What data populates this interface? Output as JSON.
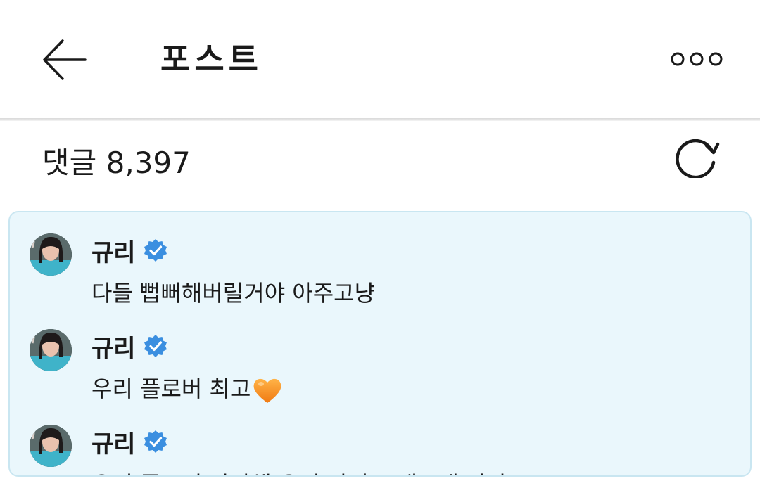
{
  "header": {
    "title": "포스트"
  },
  "comments_section": {
    "title": "댓글 8,397"
  },
  "comments": [
    {
      "username": "규리",
      "verified": true,
      "text": "다들 뻡뻐해버릴거야 아주고냥"
    },
    {
      "username": "규리",
      "verified": true,
      "text": "우리 플로버 최고",
      "emoji": "orange-heart"
    },
    {
      "username": "규리",
      "verified": true,
      "text": "우리 플로버 사랑해 우리 같이 오래오래 가자 ♡"
    }
  ],
  "colors": {
    "panel_bg": "#eaf7fc",
    "panel_border": "#c9e6f1",
    "verified_blue": "#3b8fe0",
    "heart_orange": "#f5891f"
  },
  "icons": {
    "back": "arrow-left-icon",
    "more": "more-options-icon",
    "refresh": "refresh-icon",
    "verified": "verified-badge-icon"
  }
}
